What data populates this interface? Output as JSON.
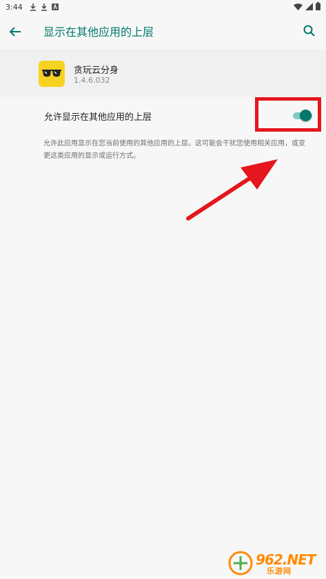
{
  "status_bar": {
    "time": "3:44",
    "left_icons": [
      "download-icon",
      "download-icon",
      "app-notification-icon"
    ],
    "right_icons": [
      "wifi-icon",
      "signal-icon",
      "battery-icon"
    ]
  },
  "app_bar": {
    "title": "显示在其他应用的上层",
    "back_icon": "arrow-back-icon",
    "search_icon": "search-icon",
    "accent_color": "#00796b"
  },
  "app_info": {
    "name": "贪玩云分身",
    "version": "1.4.6.032",
    "icon_color": "#f6d320"
  },
  "setting": {
    "label": "允许显示在其他应用的上层",
    "toggle_on": true,
    "description": "允许此应用显示在您当前使用的其他应用的上层。这可能会干扰您使用相关应用，或变更这类应用的显示或运行方式。"
  },
  "annotation": {
    "highlight_color": "#e5161d"
  },
  "watermark": {
    "line1": "962.NET",
    "line2": "乐游网"
  }
}
